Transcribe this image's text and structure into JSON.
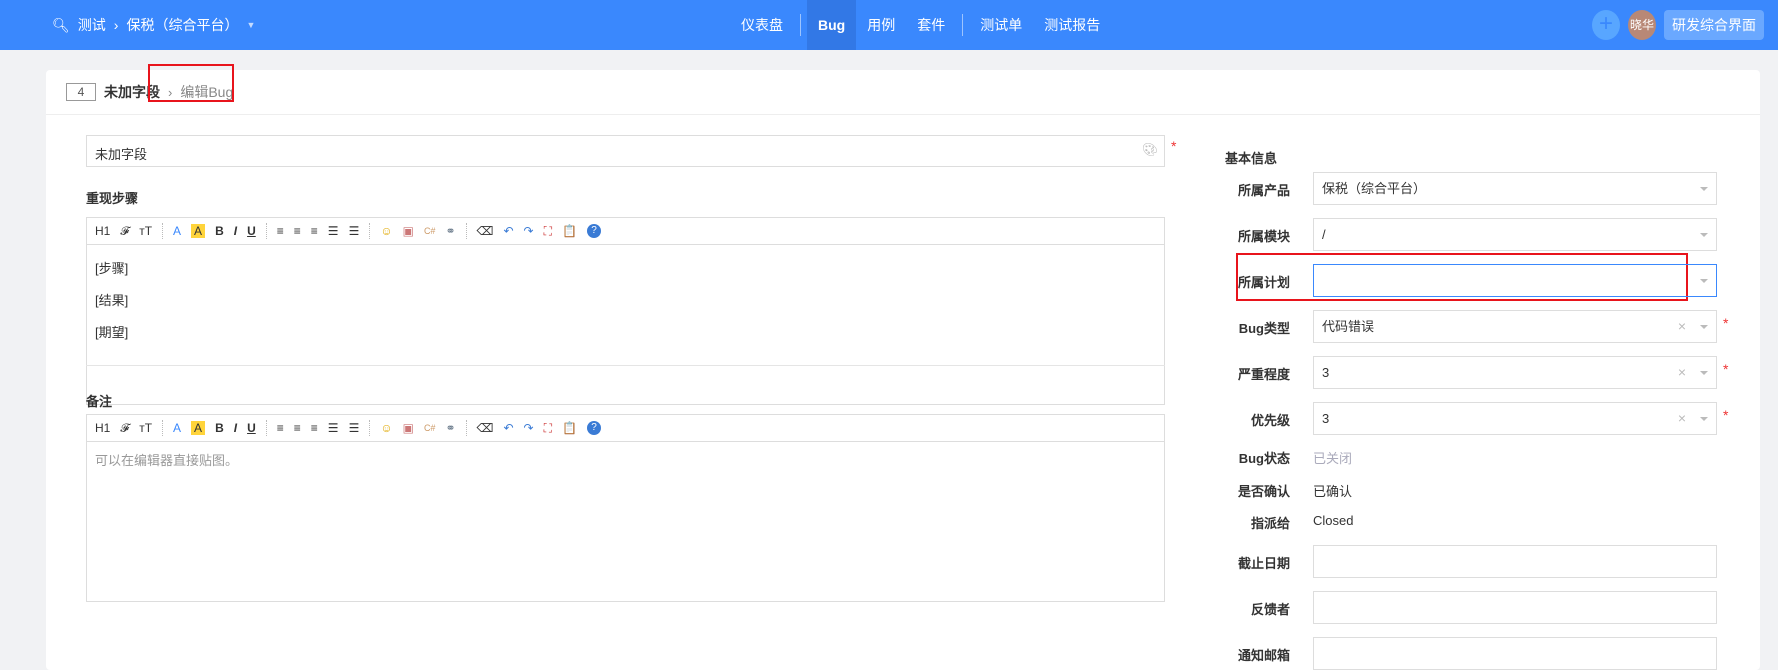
{
  "header": {
    "search_icon": "search-icon",
    "product": "测试",
    "project": "保税（综合平台）",
    "nav": [
      "仪表盘",
      "Bug",
      "用例",
      "套件",
      "测试单",
      "测试报告"
    ],
    "active": "Bug",
    "avatar": "晓华",
    "switch_label": "研发综合界面",
    "colors": {
      "primary": "#3a88fd"
    }
  },
  "page": {
    "id": "4",
    "title": "未加字段",
    "current": "编辑Bug"
  },
  "form": {
    "title_value": "未加字段",
    "steps_label": "重现步骤",
    "steps_lines": [
      "[步骤]",
      "[结果]",
      "[期望]"
    ],
    "comment_label": "备注",
    "comment_placeholder": "可以在编辑器直接贴图。",
    "toolbar": [
      "H1",
      "𝓕",
      "ᴛT",
      "A",
      "A",
      "B",
      "I",
      "U",
      "≡",
      "≡",
      "≡",
      "☰",
      "☰",
      "☺",
      "▣",
      "C#",
      "⚭",
      "⌫",
      "↶",
      "↷",
      "⛶",
      "📋",
      "?"
    ]
  },
  "basic": {
    "heading": "基本信息",
    "fields": [
      {
        "label": "所属产品",
        "value": "保税（综合平台）"
      },
      {
        "label": "所属模块",
        "value": "/"
      },
      {
        "label": "所属计划",
        "value": ""
      },
      {
        "label": "Bug类型",
        "value": "代码错误"
      },
      {
        "label": "严重程度",
        "value": "3"
      },
      {
        "label": "优先级",
        "value": "3"
      }
    ],
    "status_label": "Bug状态",
    "status": "已关闭",
    "confirm_label": "是否确认",
    "confirm": "已确认",
    "assign_label": "指派给",
    "assign": "Closed",
    "deadline_label": "截止日期",
    "feedback_label": "反馈者",
    "mail_label": "通知邮箱"
  }
}
